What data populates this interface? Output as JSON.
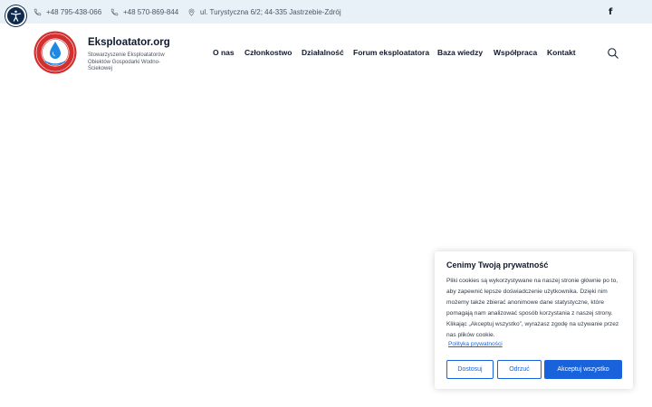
{
  "topbar": {
    "phone1": "+48 795-438-066",
    "phone2": "+48 570-869-844",
    "address": "ul. Turystyczna 6/2; 44-335 Jastrzebie-Zdrój",
    "facebook_icon": "facebook-icon",
    "background": "#e8f1f8"
  },
  "accessibility": {
    "icon": "accessibility-icon",
    "color": "#0f2a4d"
  },
  "header": {
    "title": "Eksploatator.org",
    "subtitle": "Stowarzyszenie Eksploatatorów Obiektów Gospodarki Wodno-Ściekowej",
    "logo_icon": "water-drop-logo"
  },
  "nav": {
    "items": [
      {
        "label": "O nas"
      },
      {
        "label": "Członkostwo"
      },
      {
        "label": "Działalność"
      },
      {
        "label": "Forum eksploatatora"
      },
      {
        "label": "Baza wiedzy"
      },
      {
        "label": "Współpraca"
      },
      {
        "label": "Kontakt"
      }
    ],
    "search_icon": "search-icon"
  },
  "cookie": {
    "title": "Cenimy Twoją prywatność",
    "text": "Pliki cookies są wykorzystywane na naszej stronie głównie po to, aby zapewnić lepsze doświadczenie użytkownika. Dzięki nim możemy także zbierać anonimowe dane statystyczne, które pomagają nam analizować sposób korzystania z naszej strony. Klikając „Akceptuj wszystko”, wyrażasz zgodę na używanie przez nas plików cookie.",
    "link": "Polityka prywatności",
    "buttons": {
      "customize": "Dostosuj",
      "reject": "Odrzuć",
      "accept": "Akceptuj wszystko"
    },
    "accent": "#1863dc"
  }
}
